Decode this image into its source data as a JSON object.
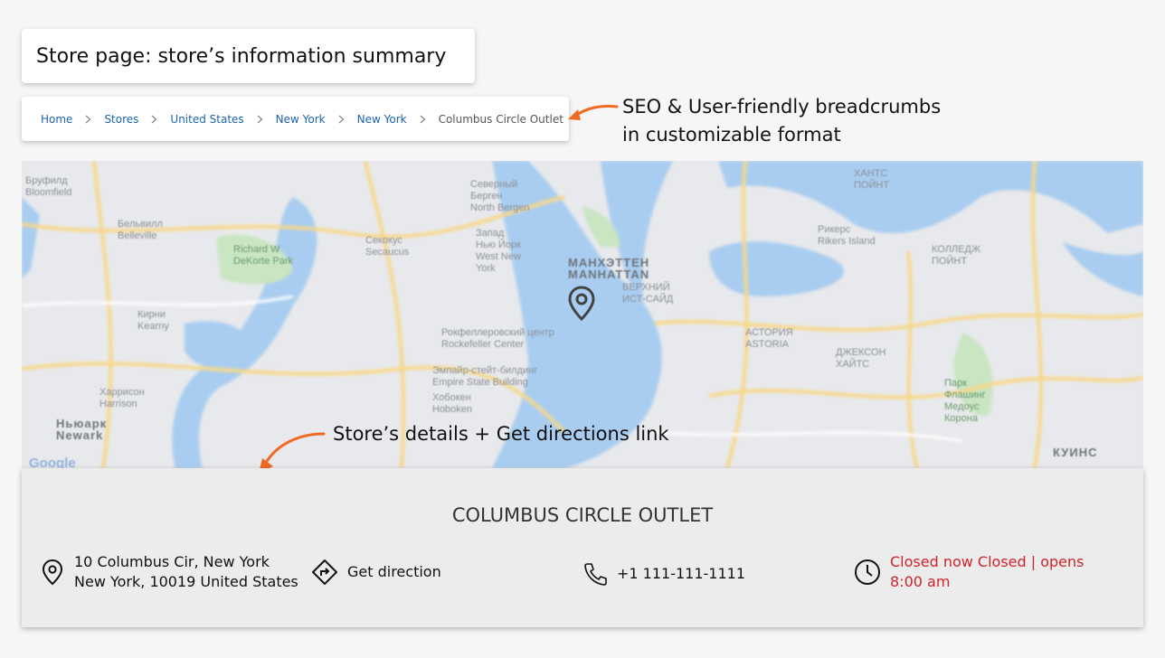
{
  "page_title": "Store page: store’s information summary",
  "breadcrumbs": [
    {
      "label": "Home"
    },
    {
      "label": "Stores"
    },
    {
      "label": "United States"
    },
    {
      "label": "New York"
    },
    {
      "label": "New York"
    },
    {
      "label": "Columbus Circle Outlet"
    }
  ],
  "callouts": {
    "breadcrumbs_line1": "SEO & User-friendly breadcrumbs",
    "breadcrumbs_line2": "in customizable format",
    "details": "Store’s details + Get directions link"
  },
  "map": {
    "labels": [
      "Бруфилд\nBloomfield",
      "Бельвилл\nBelleville",
      "Richard W\nDeKorte Park",
      "Секокус\nSecaucus",
      "Северный\nБерген\nNorth Bergen",
      "Запад\nНью Йорк\nWest New\nYork",
      "МАНХЭТТЕН\nMANHATTAN",
      "Рокфеллеровский центр\nRockefeller Center",
      "Эмпайр-стейт-билдинг\nEmpire State Building",
      "Хобокен\nHoboken",
      "Харрисон\nHarrison",
      "Ньюарк\nNewark",
      "Кирни\nKearny",
      "Рикерс\nRikers Island",
      "Парк\nФлашинг\nМедоус\nКорона",
      "КУИНС",
      "АСТОРИЯ\nASTORIA",
      "ДЖЕКСОН\nХАЙТС",
      "ВЕРХНИЙ\nИСТ-САЙД",
      "КОЛЛЕДЖ\nПОЙНТ",
      "ХАНТС\nПОЙНТ"
    ],
    "logo": "Google"
  },
  "store": {
    "name": "COLUMBUS CIRCLE OUTLET",
    "address_line1": "10 Columbus Cir, New York",
    "address_line2": "New York, 10019 United States",
    "direction_label": "Get direction",
    "phone": "+1 111-111-1111",
    "hours_line1": "Closed now Closed | opens",
    "hours_line2": "8:00 am"
  },
  "colors": {
    "link": "#1a63b0",
    "accent_arrow": "#f06a22",
    "closed_status": "#d0232a"
  },
  "icons": [
    "chevron-right-icon",
    "arrow-icon",
    "map-pin-icon",
    "location-pin-icon",
    "direction-icon",
    "phone-icon",
    "clock-icon"
  ]
}
